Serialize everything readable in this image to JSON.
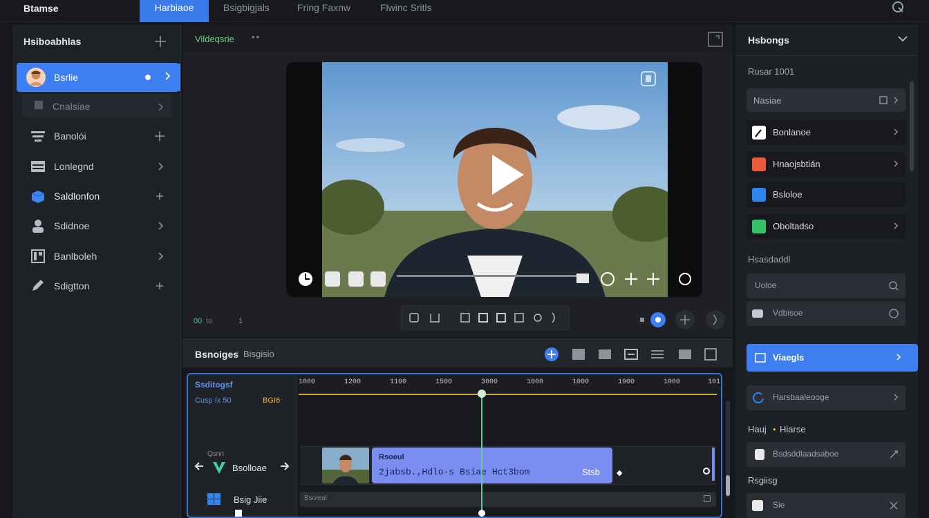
{
  "app": {
    "title": "Btamse"
  },
  "topbar": {
    "tabs": [
      {
        "label": "Harbiaoe",
        "active": true
      },
      {
        "label": "Bsigbigjals"
      },
      {
        "label": "Fring Faxnw"
      },
      {
        "label": "Flwinc Sritls"
      }
    ],
    "search_icon": "search-icon"
  },
  "left_panel": {
    "header": "Hsiboabhlas",
    "items": [
      {
        "label": "Bsrlie",
        "icon": "avatar",
        "trailing": "chevron"
      },
      {
        "label": "Cnalsiae",
        "icon": "square-icon",
        "trailing": "chevron"
      },
      {
        "label": "Banolói",
        "icon": "list-icon",
        "trailing": "plus"
      },
      {
        "label": "Lonlegnd",
        "icon": "calendar-icon",
        "trailing": "chevron"
      },
      {
        "label": "Saldlonfon",
        "icon": "box-icon",
        "trailing": "plus"
      },
      {
        "label": "Sdidnoe",
        "icon": "user-icon",
        "trailing": "chevron"
      },
      {
        "label": "Banlboleh",
        "icon": "grid-icon",
        "trailing": "chevron"
      },
      {
        "label": "Sdigtton",
        "icon": "pen-icon",
        "trailing": "plus"
      }
    ]
  },
  "viewer": {
    "title": "Vildeqsrie",
    "status_left": "00",
    "status_left2": "1",
    "status_sub": "to"
  },
  "timeline": {
    "header_title": "Bsnoiges",
    "header_sub": "Bisgisio",
    "track_title": "Ssditogsf",
    "track_meta": "Cusp Ix  50",
    "track_meta_accent": "BGI6",
    "video_track_tag": "Qsnn",
    "video_track_name": "Bsolloae",
    "audio_track_name": "Bsig Jiie",
    "ruler_ticks": [
      "1000",
      "1200",
      "1100",
      "1500",
      "3000",
      "1000",
      "1000",
      "1900",
      "1000",
      "101"
    ],
    "clip_title": "Rsoeul",
    "clip_text": "2jabsb.,Hdlo-s Bsiae Hct3bom",
    "clip_end": "Stsb",
    "audio_clip_label": "Bsoieal"
  },
  "right_panel": {
    "title": "Hsbongs",
    "section1": "Rusar 1001",
    "input1": "Nasiae",
    "rows": [
      {
        "label": "Bonlanoe",
        "color": "#ffffff"
      },
      {
        "label": "Hnaojsbtián",
        "color": "#ea5a3c"
      },
      {
        "label": "Bsloloe",
        "color": "#2d86f0"
      },
      {
        "label": "Oboltadso",
        "color": "#33c16a"
      }
    ],
    "section2": "Hsasdaddl",
    "field2": "Uoloe",
    "field3": "Vdbisoe",
    "active_item": "Viaegls",
    "loading_item": "Harsbaaleooge",
    "section3": "Hauj",
    "section3_accent": "Hiarse",
    "field4": "Bsdsddlaadsaboe",
    "section4": "Rsgiisg",
    "field5": "Sie"
  },
  "colors": {
    "accent": "#3d7ff0",
    "green": "#62d09a",
    "bg": "#15171b"
  }
}
